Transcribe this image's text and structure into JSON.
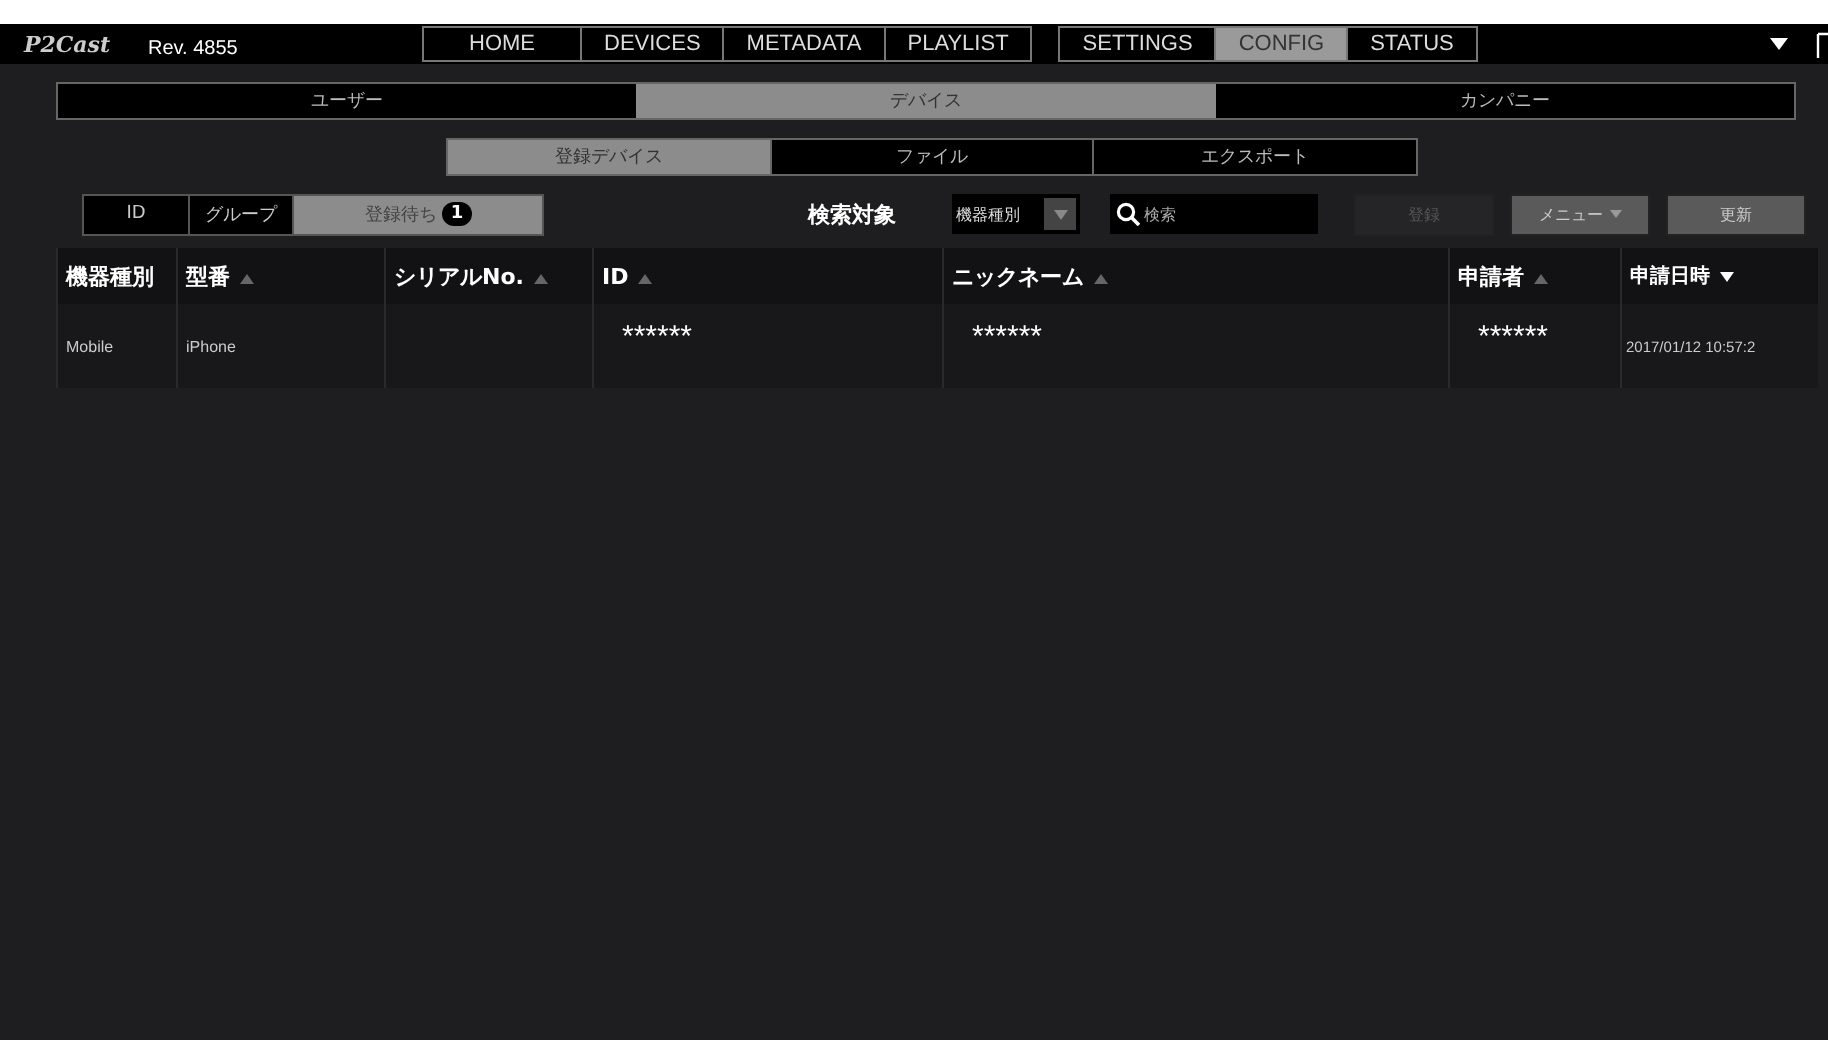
{
  "header": {
    "logo": "P2Cast",
    "revision": "Rev. 4855",
    "nav_groups": [
      {
        "items": [
          {
            "label": "HOME",
            "selected": false
          },
          {
            "label": "DEVICES",
            "selected": false
          },
          {
            "label": "METADATA",
            "selected": false
          },
          {
            "label": "PLAYLIST",
            "selected": false
          }
        ]
      },
      {
        "items": [
          {
            "label": "SETTINGS",
            "selected": false
          },
          {
            "label": "CONFIG",
            "selected": true
          },
          {
            "label": "STATUS",
            "selected": false
          }
        ]
      }
    ]
  },
  "main_tabs": [
    {
      "label": "ユーザー",
      "selected": false
    },
    {
      "label": "デバイス",
      "selected": true
    },
    {
      "label": "カンパニー",
      "selected": false
    }
  ],
  "sub_tabs": [
    {
      "label": "登録デバイス",
      "selected": true
    },
    {
      "label": "ファイル",
      "selected": false
    },
    {
      "label": "エクスポート",
      "selected": false
    }
  ],
  "filter_tabs": [
    {
      "label": "ID",
      "selected": false
    },
    {
      "label": "グループ",
      "selected": false
    },
    {
      "label": "登録待ち",
      "selected": true,
      "badge": "1"
    }
  ],
  "search": {
    "label": "検索対象",
    "target": "機器種別",
    "placeholder": "検索"
  },
  "buttons": [
    {
      "label": "登録",
      "disabled": true,
      "dropdown": false
    },
    {
      "label": "メニュー",
      "disabled": false,
      "dropdown": true
    },
    {
      "label": "更新",
      "disabled": false,
      "dropdown": false
    }
  ],
  "table": {
    "columns": [
      {
        "label": "機器種別"
      },
      {
        "label": "型番",
        "sorted_desc": false
      },
      {
        "label": "シリアルNo.",
        "sorted_desc": false
      },
      {
        "label": "ID",
        "sorted_desc": false
      },
      {
        "label": "ニックネーム",
        "sorted_desc": false
      },
      {
        "label": "申請者",
        "sorted_desc": false
      },
      {
        "label": "申請日時",
        "sorted_desc": true
      }
    ],
    "rows": [
      {
        "cells": [
          "Mobile",
          "iPhone",
          "",
          "******",
          "******",
          "******",
          "2017/01/12 10:57:2"
        ]
      }
    ]
  }
}
